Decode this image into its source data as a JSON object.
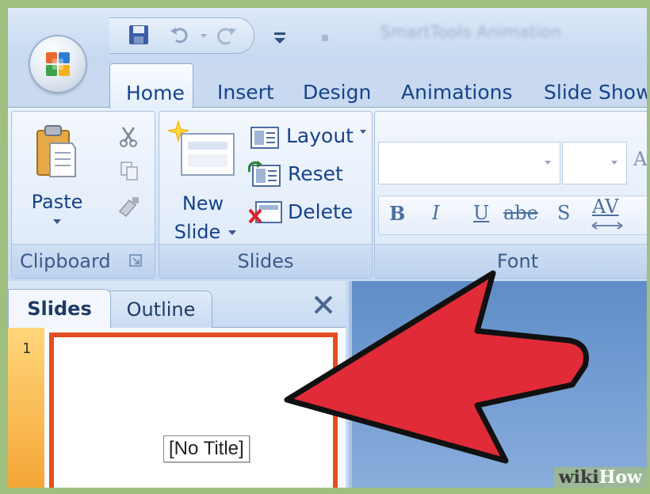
{
  "titlebar": {
    "doc_title": "SmartTools Animation"
  },
  "tabs": [
    {
      "label": "Home",
      "active": true
    },
    {
      "label": "Insert"
    },
    {
      "label": "Design"
    },
    {
      "label": "Animations"
    },
    {
      "label": "Slide Show"
    }
  ],
  "ribbon": {
    "clipboard": {
      "paste_label": "Paste",
      "group_label": "Clipboard"
    },
    "slides": {
      "new_slide_line1": "New",
      "new_slide_line2": "Slide",
      "layout_label": "Layout",
      "reset_label": "Reset",
      "delete_label": "Delete",
      "group_label": "Slides"
    },
    "font": {
      "group_label": "Font",
      "bold": "B",
      "italic": "I",
      "underline": "U",
      "strike": "abe",
      "shadow": "S",
      "spacing": "AV",
      "grow": "A"
    }
  },
  "pane": {
    "tab_slides": "Slides",
    "tab_outline": "Outline",
    "close_symbol": "✕",
    "slide_number": "1",
    "slide_title": "[No Title]"
  },
  "watermark": {
    "part1": "wiki",
    "part2": "How"
  },
  "colors": {
    "accent_blue": "#15428b",
    "arrow_red": "#e12b38",
    "slide_border": "#e54e23"
  }
}
